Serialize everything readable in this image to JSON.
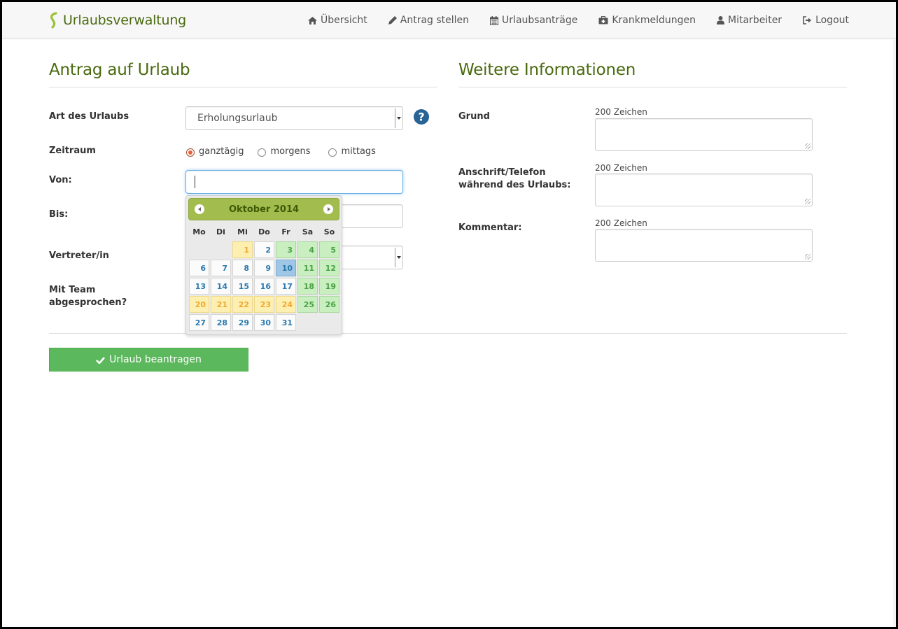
{
  "app": {
    "brand": "Urlaubsverwaltung"
  },
  "nav": {
    "items": [
      {
        "label": "Übersicht",
        "icon": "home-icon"
      },
      {
        "label": "Antrag stellen",
        "icon": "pencil-icon"
      },
      {
        "label": "Urlaubsanträge",
        "icon": "calendar-icon"
      },
      {
        "label": "Krankmeldungen",
        "icon": "medkit-icon"
      },
      {
        "label": "Mitarbeiter",
        "icon": "user-icon"
      },
      {
        "label": "Logout",
        "icon": "sign-out-icon"
      }
    ]
  },
  "form": {
    "heading": "Antrag auf Urlaub",
    "art_label": "Art des Urlaubs",
    "art_value": "Erholungsurlaub",
    "zeitraum_label": "Zeitraum",
    "zeitraum_options": [
      "ganztägig",
      "morgens",
      "mittags"
    ],
    "zeitraum_selected": "ganztägig",
    "von_label": "Von:",
    "von_value": "",
    "bis_label": "Bis:",
    "vertreter_label": "Vertreter/in",
    "team_label_line1": "Mit Team",
    "team_label_line2": "abgesprochen?"
  },
  "info": {
    "heading": "Weitere Informationen",
    "grund_label": "Grund",
    "anschrift_label_line1": "Anschrift/Telefon",
    "anschrift_label_line2": "während des Urlaubs:",
    "kommentar_label": "Kommentar:",
    "counter": "200 Zeichen"
  },
  "datepicker": {
    "title": "Oktober 2014",
    "weekdays": [
      "Mo",
      "Di",
      "Mi",
      "Do",
      "Fr",
      "Sa",
      "So"
    ],
    "leading_blanks": 2,
    "days": [
      {
        "d": "1",
        "t": "holiday"
      },
      {
        "d": "2",
        "t": "normal"
      },
      {
        "d": "3",
        "t": "weekend"
      },
      {
        "d": "4",
        "t": "weekend"
      },
      {
        "d": "5",
        "t": "weekend"
      },
      {
        "d": "6",
        "t": "normal"
      },
      {
        "d": "7",
        "t": "normal"
      },
      {
        "d": "8",
        "t": "normal"
      },
      {
        "d": "9",
        "t": "normal"
      },
      {
        "d": "10",
        "t": "today"
      },
      {
        "d": "11",
        "t": "weekend"
      },
      {
        "d": "12",
        "t": "weekend"
      },
      {
        "d": "13",
        "t": "normal"
      },
      {
        "d": "14",
        "t": "normal"
      },
      {
        "d": "15",
        "t": "normal"
      },
      {
        "d": "16",
        "t": "normal"
      },
      {
        "d": "17",
        "t": "normal"
      },
      {
        "d": "18",
        "t": "weekend"
      },
      {
        "d": "19",
        "t": "weekend"
      },
      {
        "d": "20",
        "t": "holiday"
      },
      {
        "d": "21",
        "t": "holiday"
      },
      {
        "d": "22",
        "t": "holiday"
      },
      {
        "d": "23",
        "t": "holiday"
      },
      {
        "d": "24",
        "t": "holiday"
      },
      {
        "d": "25",
        "t": "weekend"
      },
      {
        "d": "26",
        "t": "weekend"
      },
      {
        "d": "27",
        "t": "normal"
      },
      {
        "d": "28",
        "t": "normal"
      },
      {
        "d": "29",
        "t": "normal"
      },
      {
        "d": "30",
        "t": "normal"
      },
      {
        "d": "31",
        "t": "normal"
      }
    ]
  },
  "submit_label": "Urlaub beantragen",
  "colors": {
    "brand_green": "#4a6a10",
    "header_green": "#a2bd4e",
    "submit_green": "#5cb85c",
    "help_blue": "#2a6496"
  }
}
